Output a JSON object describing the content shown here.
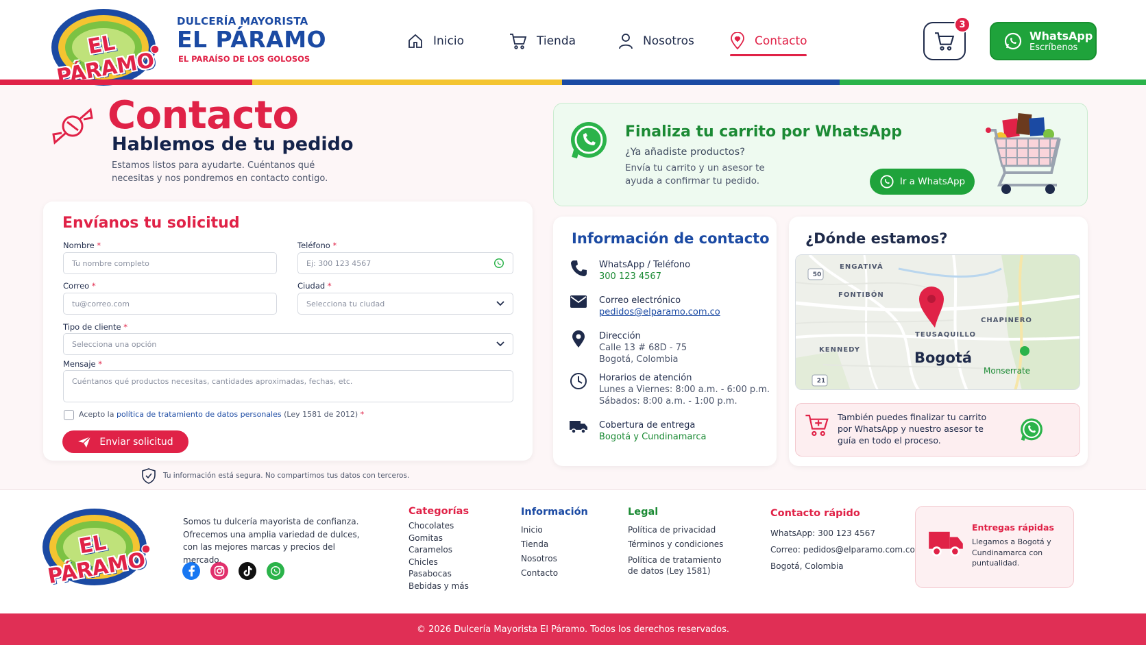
{
  "brand": {
    "logo_text": "EL PÁRAMO",
    "top": "DULCERÍA MAYORISTA",
    "name": "EL PÁRAMO",
    "tagline": "EL PARAÍSO DE LOS GOLOSOS"
  },
  "nav": {
    "items": [
      {
        "label": "Inicio",
        "icon": "home-icon"
      },
      {
        "label": "Tienda",
        "icon": "cart-icon"
      },
      {
        "label": "Nosotros",
        "icon": "user-icon"
      },
      {
        "label": "Contacto",
        "icon": "location-heart-icon"
      }
    ],
    "active": "Contacto",
    "cart_count": "3",
    "whatsapp_label": "WhatsApp",
    "whatsapp_sub": "Escríbenos"
  },
  "colors": {
    "red": "#e02247",
    "yellow": "#f4c431",
    "blue": "#1b4aa3",
    "green": "#2bb34a"
  },
  "hero": {
    "title": "Contacto",
    "subtitle": "Hablemos de tu pedido",
    "description": "Estamos listos para ayudarte. Cuéntanos qué necesitas y nos pondremos en contacto contigo."
  },
  "form": {
    "title": "Envíanos tu solicitud",
    "name_label": "Nombre",
    "name_placeholder": "Tu nombre completo",
    "phone_label": "Teléfono",
    "phone_placeholder": "Ej: 300 123 4567",
    "email_label": "Correo",
    "email_placeholder": "tu@correo.com",
    "city_label": "Ciudad",
    "city_value": "Selecciona tu ciudad",
    "client_label": "Tipo de cliente",
    "client_value": "Selecciona una opción",
    "message_label": "Mensaje",
    "message_placeholder": "Cuéntanos qué productos necesitas, cantidades aproximadas, fechas, etc.",
    "required_mark": "*",
    "consent_prefix": "Acepto la",
    "consent_link": "política de tratamiento de datos personales",
    "consent_suffix": "(Ley 1581 de 2012)",
    "submit": "Enviar solicitud",
    "secure_note": "Tu información está segura. No compartimos tus datos con terceros."
  },
  "whatsapp_banner": {
    "title": "Finaliza tu carrito por WhatsApp",
    "question": "¿Ya añadiste productos?",
    "description": "Envía tu carrito y un asesor te ayuda a confirmar tu pedido.",
    "button": "Ir a WhatsApp"
  },
  "contact_info": {
    "title": "Información de contacto",
    "rows": [
      {
        "label": "WhatsApp / Teléfono",
        "value": "300 123 4567"
      },
      {
        "label": "Correo electrónico",
        "value": "pedidos@elparamo.com.co"
      },
      {
        "label": "Dirección",
        "value": "Calle 13 # 68D - 75",
        "value2": "Bogotá, Colombia"
      },
      {
        "label": "Horarios de atención",
        "value": "Lunes a Viernes: 8:00 a.m. - 6:00 p.m.",
        "value2": "Sábados: 8:00 a.m. - 1:00 p.m."
      },
      {
        "label": "Cobertura de entrega",
        "value": "Bogotá y Cundinamarca"
      }
    ]
  },
  "location": {
    "title": "¿Dónde estamos?",
    "map_labels": {
      "engativa": "ENGATIVÁ",
      "fontibon": "FONTIBÓN",
      "chapinero": "CHAPINERO",
      "teusaquillo": "TEUSAQUILLO",
      "kennedy": "KENNEDY",
      "city": "Bogotá",
      "monserrate": "Monserrate",
      "route_50": "50",
      "route_21": "21"
    },
    "also_text": "También puedes finalizar tu carrito por WhatsApp y nuestro asesor te guía en todo el proceso."
  },
  "footer": {
    "about": "Somos tu dulcería mayorista de confianza. Ofrecemos una amplia variedad de dulces, con las mejores marcas y precios del mercado.",
    "categories": {
      "title": "Categorías",
      "items": [
        "Chocolates",
        "Gomitas",
        "Caramelos",
        "Chicles",
        "Pasabocas",
        "Bebidas y más"
      ]
    },
    "information": {
      "title": "Información",
      "items": [
        "Inicio",
        "Tienda",
        "Nosotros",
        "Contacto"
      ]
    },
    "legal": {
      "title": "Legal",
      "items": [
        "Política de privacidad",
        "Términos y condiciones",
        "Política de tratamiento",
        "de datos (Ley 1581)"
      ]
    },
    "quick": {
      "title": "Contacto rápido",
      "items": [
        "WhatsApp: 300 123 4567",
        "Correo: pedidos@elparamo.com.co",
        "Bogotá, Colombia"
      ]
    },
    "delivery_title": "Entregas rápidas",
    "delivery_text": "Llegamos a Bogotá y Cundinamarca con puntualidad.",
    "copyright": "© 2026 Dulcería Mayorista El Páramo. Todos los derechos reservados."
  }
}
